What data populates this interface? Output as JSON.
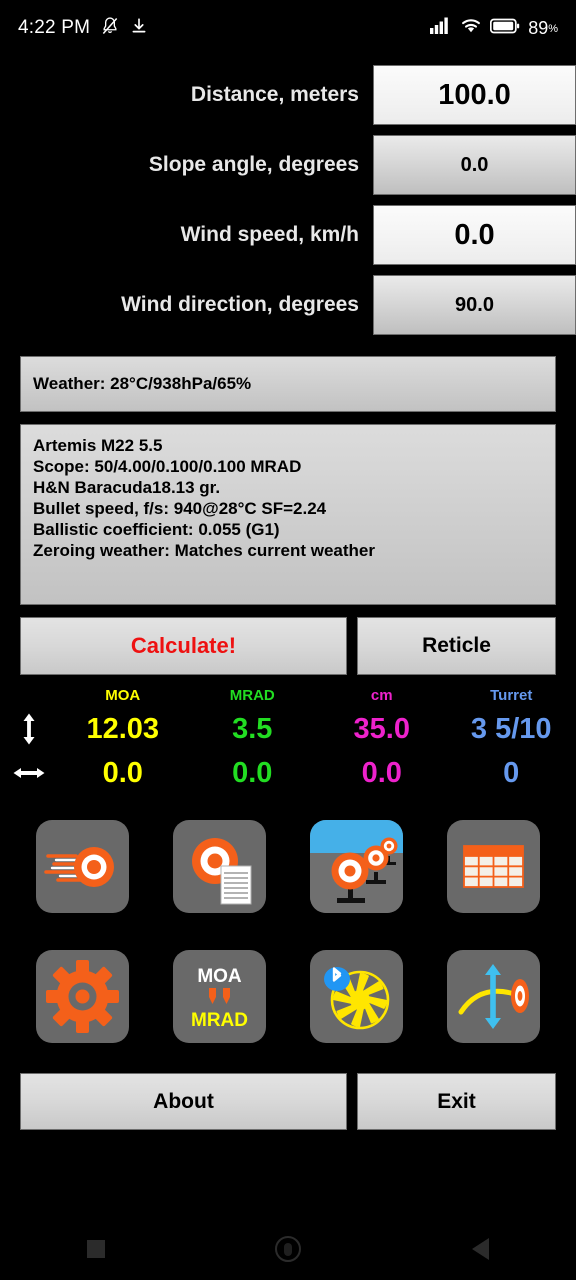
{
  "statusbar": {
    "time": "4:22 PM",
    "battery_pct": "89",
    "pct_sign": "%",
    "icons": [
      "bell-muted-icon",
      "download-icon",
      "signal-icon",
      "wifi-icon",
      "battery-icon"
    ]
  },
  "inputs": [
    {
      "label": "Distance, meters",
      "value": "100.0",
      "style": "light"
    },
    {
      "label": "Slope angle, degrees",
      "value": "0.0",
      "style": "gray"
    },
    {
      "label": "Wind speed, km/h",
      "value": "0.0",
      "style": "light"
    },
    {
      "label": "Wind direction, degrees",
      "value": "90.0",
      "style": "gray"
    }
  ],
  "weather": {
    "text": "Weather: 28°C/938hPa/65%"
  },
  "profile": {
    "lines": [
      "Artemis M22 5.5",
      "Scope: 50/4.00/0.100/0.100 MRAD",
      "H&N Baracuda18.13 gr.",
      "Bullet speed, f/s: 940@28°C SF=2.24",
      "Ballistic coefficient: 0.055 (G1)",
      "Zeroing weather: Matches current weather"
    ]
  },
  "actions": {
    "calculate_label": "Calculate!",
    "calculate_color": "#ee1111",
    "reticle_label": "Reticle"
  },
  "results": {
    "headers": [
      {
        "label": "MOA",
        "color": "#ffff00"
      },
      {
        "label": "MRAD",
        "color": "#22dd22"
      },
      {
        "label": "cm",
        "color": "#ee22cc"
      },
      {
        "label": "Turret",
        "color": "#6699ee"
      }
    ],
    "rows": [
      {
        "arrow": "vertical-double-arrow-icon",
        "values": [
          {
            "text": "12.03",
            "color": "#ffff00"
          },
          {
            "text": "3.5",
            "color": "#22dd22"
          },
          {
            "text": "35.0",
            "color": "#ee22cc"
          },
          {
            "text": "3 5/10",
            "color": "#6699ee"
          }
        ]
      },
      {
        "arrow": "horizontal-double-arrow-icon",
        "values": [
          {
            "text": "0.0",
            "color": "#ffff00"
          },
          {
            "text": "0.0",
            "color": "#22dd22"
          },
          {
            "text": "0.0",
            "color": "#ee22cc"
          },
          {
            "text": "0",
            "color": "#6699ee"
          }
        ]
      }
    ]
  },
  "icon_grid": {
    "row1": [
      {
        "name": "trajectory-target-icon"
      },
      {
        "name": "target-list-icon"
      },
      {
        "name": "multi-target-range-icon"
      },
      {
        "name": "ballistic-table-icon"
      }
    ],
    "row2": [
      {
        "name": "settings-gear-icon"
      },
      {
        "name": "moa-mrad-converter-icon",
        "top_text": "MOA",
        "bottom_text": "MRAD",
        "top_color": "#ffffff",
        "bottom_color": "#ffff00"
      },
      {
        "name": "bluetooth-weather-station-icon"
      },
      {
        "name": "zeroing-trajectory-icon"
      }
    ]
  },
  "footer": {
    "about_label": "About",
    "exit_label": "Exit"
  },
  "navbar": {
    "items": [
      {
        "name": "recents-button"
      },
      {
        "name": "home-button"
      },
      {
        "name": "back-button"
      }
    ]
  },
  "theme": {
    "background": "#000000",
    "accent_orange": "#f4601a",
    "tile_gray": "#696969",
    "sky_blue": "#45b0e8",
    "yellow": "#ffff00"
  }
}
